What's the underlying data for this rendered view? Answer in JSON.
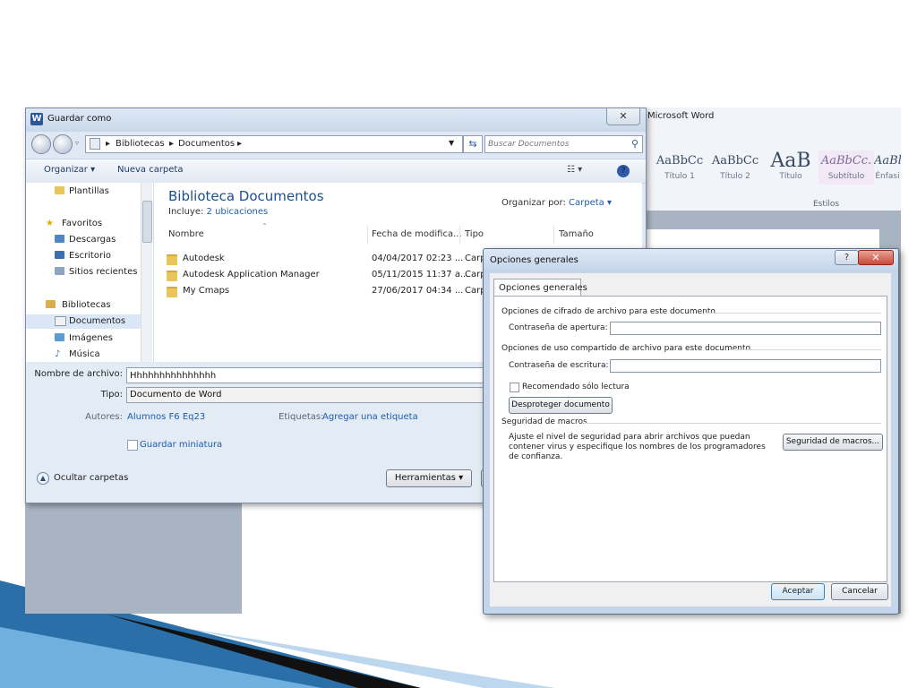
{
  "word": {
    "title": "Microsoft Word",
    "styles": [
      {
        "preview": "AaBbCс",
        "label": "Título 1"
      },
      {
        "preview": "AaBbCc",
        "label": "Título 2"
      },
      {
        "preview": "AaB",
        "label": "Título"
      },
      {
        "preview": "AaBbCc.",
        "label": "Subtítulo"
      },
      {
        "preview": "AaBl",
        "label": "Énfasi"
      }
    ],
    "styles_group_label": "Estilos"
  },
  "save_dialog": {
    "title": "Guardar como",
    "close_glyph": "✕",
    "breadcrumb": [
      "Bibliotecas",
      "Documentos"
    ],
    "search_placeholder": "Buscar Documentos",
    "toolbar": {
      "organize": "Organizar ▾",
      "new_folder": "Nueva carpeta",
      "help": "?"
    },
    "nav_items": [
      {
        "label": "Plantillas"
      },
      {
        "label": "Favoritos"
      },
      {
        "label": "Descargas"
      },
      {
        "label": "Escritorio"
      },
      {
        "label": "Sitios recientes"
      },
      {
        "label": "Bibliotecas"
      },
      {
        "label": "Documentos"
      },
      {
        "label": "Imágenes"
      },
      {
        "label": "Música"
      }
    ],
    "library_title": "Biblioteca Documentos",
    "includes_label": "Incluye:",
    "includes_link": "2 ubicaciones",
    "arrange_label": "Organizar por:",
    "arrange_value": "Carpeta ▾",
    "columns": [
      "Nombre",
      "Fecha de modifica...",
      "Tipo",
      "Tamaño"
    ],
    "files": [
      {
        "name": "Autodesk",
        "date": "04/04/2017 02:23 ...",
        "type": "Carp"
      },
      {
        "name": "Autodesk Application Manager",
        "date": "05/11/2015 11:37 a...",
        "type": "Carp"
      },
      {
        "name": "My Cmaps",
        "date": "27/06/2017 04:34 ...",
        "type": "Carp"
      }
    ],
    "filename_label": "Nombre de archivo:",
    "filename_value": "Hhhhhhhhhhhhhhh",
    "type_label": "Tipo:",
    "type_value": "Documento de Word",
    "authors_label": "Autores:",
    "authors_value": "Alumnos F6 Eq23",
    "tags_label": "Etiquetas:",
    "tags_value": "Agregar una etiqueta",
    "thumbnail_label": "Guardar miniatura",
    "hide_folders_label": "Ocultar carpetas",
    "tools_button": "Herramientas ▾"
  },
  "options_dialog": {
    "title": "Opciones generales",
    "help_glyph": "?",
    "close_glyph": "✕",
    "tab_label": "Opciones generales",
    "encryption_section": "Opciones de cifrado de archivo para este documento",
    "open_password_label": "Contraseña de apertura:",
    "open_password_value": "",
    "sharing_section": "Opciones de uso compartido de archivo para este documento",
    "write_password_label": "Contraseña de escritura:",
    "write_password_value": "",
    "readonly_label": "Recomendado sólo lectura",
    "unprotect_button": "Desproteger documento",
    "macro_section": "Seguridad de macros",
    "macro_description": "Ajuste el nivel de seguridad para abrir archivos que puedan contener virus y especifique los nombres de los programadores de confianza.",
    "macro_button": "Seguridad de macros...",
    "ok_button": "Aceptar",
    "cancel_button": "Cancelar"
  }
}
